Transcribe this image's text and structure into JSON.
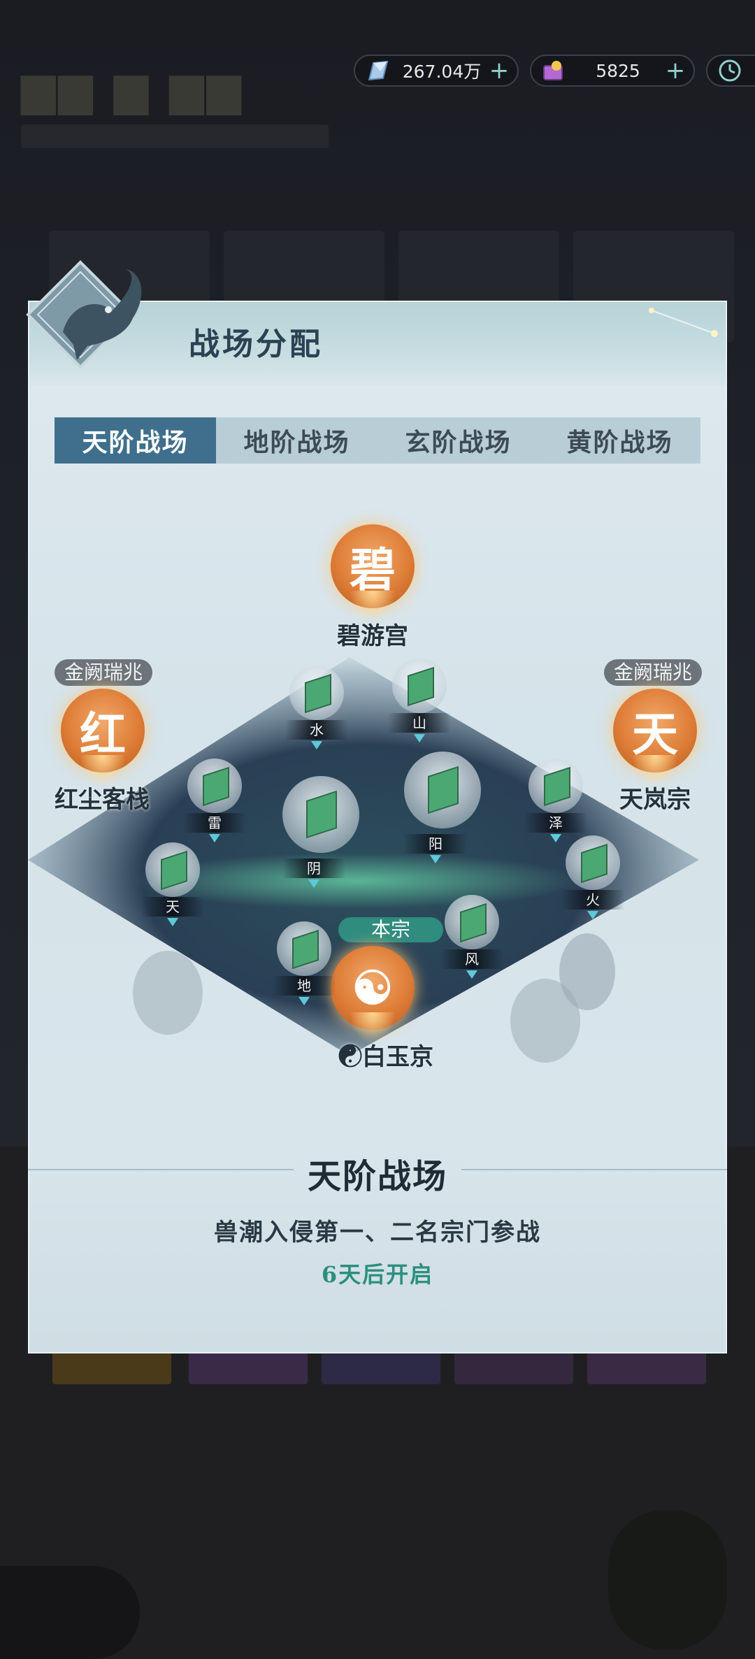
{
  "resources": {
    "spirit_stone": "267.04万",
    "ticket": "5825",
    "plus": "+"
  },
  "panel": {
    "title": "战场分配"
  },
  "tabs": [
    "天阶战场",
    "地阶战场",
    "玄阶战场",
    "黄阶战场"
  ],
  "active_tab": "天阶战场",
  "sects": {
    "top": {
      "glyph": "碧",
      "name": "碧游宫"
    },
    "left": {
      "glyph": "红",
      "name": "红尘客栈",
      "tag": "金阙瑞兆"
    },
    "right": {
      "glyph": "天",
      "name": "天岚宗",
      "tag": "金阙瑞兆"
    },
    "home": {
      "glyph": "☯",
      "name": "☯白玉京",
      "tag": "本宗"
    }
  },
  "nodes": {
    "shui": "水",
    "shan": "山",
    "lei": "雷",
    "yin": "阴",
    "yang": "阳",
    "ze": "泽",
    "tian": "天",
    "huo": "火",
    "di": "地",
    "feng": "风"
  },
  "info": {
    "title": "天阶战场",
    "desc": "兽潮入侵第一、二名宗门参战",
    "time": "6天后开启"
  },
  "colors": {
    "accent_tab": "#3f6f8c",
    "orb": "#de7d37",
    "home_tag": "#2f8c7f",
    "time_text": "#2c8f7d"
  }
}
